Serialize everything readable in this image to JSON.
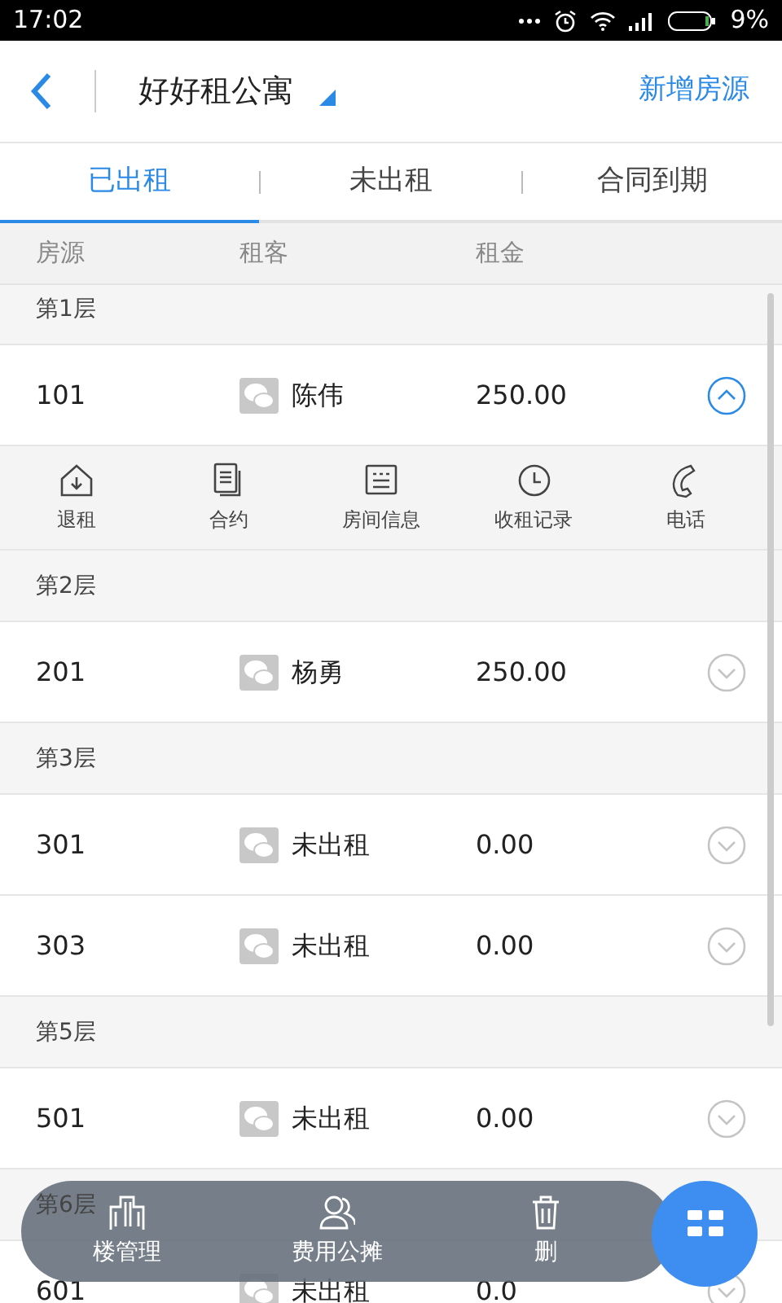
{
  "status_bar": {
    "time": "17:02",
    "battery": "9%"
  },
  "header": {
    "title": "好好租公寓",
    "action": "新增房源"
  },
  "tabs": [
    {
      "label": "已出租",
      "selected": true
    },
    {
      "label": "未出租",
      "selected": false
    },
    {
      "label": "合同到期",
      "selected": false
    }
  ],
  "columns": [
    "房源",
    "租客",
    "租金"
  ],
  "floors": [
    {
      "label": "第1层",
      "rooms": [
        {
          "room": "101",
          "tenant": "陈伟",
          "rent": "250.00",
          "expanded": true,
          "actions": [
            {
              "label": "退租",
              "kind": "checkout"
            },
            {
              "label": "合约",
              "kind": "contract"
            },
            {
              "label": "房间信息",
              "kind": "info"
            },
            {
              "label": "收租记录",
              "kind": "history"
            },
            {
              "label": "电话",
              "kind": "phone"
            }
          ]
        }
      ]
    },
    {
      "label": "第2层",
      "rooms": [
        {
          "room": "201",
          "tenant": "杨勇",
          "rent": "250.00",
          "expanded": false
        }
      ]
    },
    {
      "label": "第3层",
      "rooms": [
        {
          "room": "301",
          "tenant": "未出租",
          "rent": "0.00",
          "expanded": false
        },
        {
          "room": "303",
          "tenant": "未出租",
          "rent": "0.00",
          "expanded": false
        }
      ]
    },
    {
      "label": "第5层",
      "rooms": [
        {
          "room": "501",
          "tenant": "未出租",
          "rent": "0.00",
          "expanded": false
        }
      ]
    },
    {
      "label": "第6层",
      "rooms": [
        {
          "room": "601",
          "tenant": "未出租",
          "rent": "0.0",
          "expanded": false
        }
      ]
    }
  ],
  "bottom_bar": [
    {
      "label": "楼管理",
      "kind": "building"
    },
    {
      "label": "费用公摊",
      "kind": "people"
    },
    {
      "label": "删",
      "kind": "trash"
    }
  ]
}
